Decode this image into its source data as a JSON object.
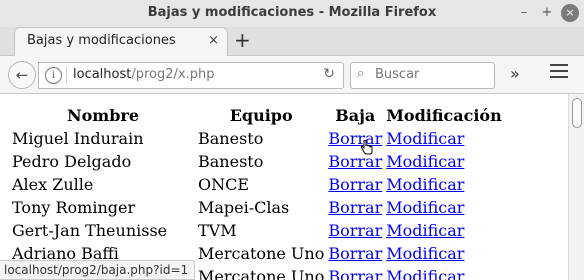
{
  "window": {
    "title": "Bajas y modificaciones - Mozilla Firefox",
    "minimize": "–",
    "maximize": "+",
    "close": "×"
  },
  "tabs": [
    {
      "label": "Bajas y modificaciones",
      "close": "×"
    }
  ],
  "new_tab": "+",
  "nav": {
    "back": "←",
    "info": "i",
    "url_host": "localhost",
    "url_path": "/prog2/x.php",
    "reload": "↻",
    "search_placeholder": "Buscar",
    "search_icon": "⌕",
    "overflow": "»"
  },
  "table": {
    "headers": [
      "Nombre",
      "Equipo",
      "Baja",
      "Modificación"
    ],
    "rows": [
      {
        "nombre": "Miguel Indurain",
        "equipo": "Banesto",
        "baja": "Borrar",
        "mod": "Modificar"
      },
      {
        "nombre": "Pedro Delgado",
        "equipo": "Banesto",
        "baja": "Borrar",
        "mod": "Modificar"
      },
      {
        "nombre": "Alex Zulle",
        "equipo": "ONCE",
        "baja": "Borrar",
        "mod": "Modificar"
      },
      {
        "nombre": "Tony Rominger",
        "equipo": "Mapei-Clas",
        "baja": "Borrar",
        "mod": "Modificar"
      },
      {
        "nombre": "Gert-Jan Theunisse",
        "equipo": "TVM",
        "baja": "Borrar",
        "mod": "Modificar"
      },
      {
        "nombre": "Adriano Baffi",
        "equipo": "Mercatone Uno",
        "baja": "Borrar",
        "mod": "Modificar"
      },
      {
        "nombre": "",
        "equipo": "Mercatone Uno",
        "baja": "Borrar",
        "mod": "Modificar"
      }
    ]
  },
  "status_url": "localhost/prog2/baja.php?id=1"
}
